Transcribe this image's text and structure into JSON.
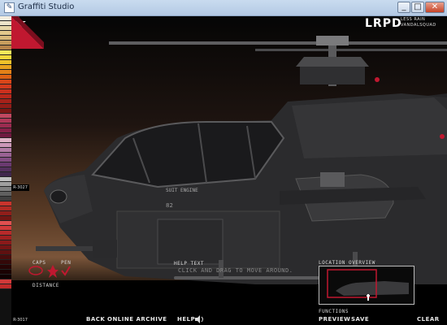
{
  "window": {
    "title": "Graffiti Studio",
    "minimize": "_",
    "maximize": "□",
    "close": "✕"
  },
  "palette": {
    "colors": [
      "#f4efe1",
      "#ece3c9",
      "#e6d6a8",
      "#e2c98c",
      "#d8b97a",
      "#c79d5e",
      "#b6834a",
      "#f5e85a",
      "#f2d83a",
      "#efc22a",
      "#e9a21e",
      "#e38118",
      "#dd6114",
      "#d8461a",
      "#d23a1e",
      "#c9301e",
      "#b8281c",
      "#a5221a",
      "#921d18",
      "#7c1714",
      "#c04860",
      "#b03858",
      "#9a2c50",
      "#862048",
      "#6f1a40",
      "#e0b4c8",
      "#cc98b8",
      "#b27ca6",
      "#9a6294",
      "#824c82",
      "#6a3a70",
      "#54305e",
      "#40264c",
      "#c0c0c0",
      "#a0a0a0",
      "#808080",
      "#606060",
      "#404040",
      "#c8342c",
      "#b02a24",
      "#901e1a",
      "#701614",
      "#e05050",
      "#d03a3a",
      "#b82a2a",
      "#a02020",
      "#8a1a1a",
      "#741414",
      "#5e1010",
      "#480c0c",
      "#340808",
      "#260404",
      "#1a0202",
      "#100000",
      "#d03a3a",
      "#c02a2a"
    ]
  },
  "logo": {
    "text": "LRPD",
    "sub_line1": "LESS RAIN",
    "sub_line2": "VANDALSQUAD",
    "icon": "star-splat-icon"
  },
  "codes": {
    "top": "R-3027",
    "bottom": "R-3017"
  },
  "tools": {
    "caps_label": "CAPS",
    "pen_label": "PEN",
    "distance_label": "DISTANCE"
  },
  "help": {
    "title": "HELP TEXT",
    "text": "CLICK AND DRAG TO MOVE AROUND."
  },
  "overview": {
    "label": "LOCATION OVERVIEW"
  },
  "functions": {
    "label": "FUNCTIONS",
    "preview": "PREVIEW",
    "save": "SAVE"
  },
  "nav": {
    "back": "BACK",
    "archive": "ONLINE ARCHIVE",
    "help": "HELP",
    "clear": "CLEAR",
    "sound_icon": "speaker-icon"
  },
  "helicopter": {
    "hull_number": "82",
    "nose_text": "SUIT ENGINE"
  },
  "colors": {
    "accent_red": "#c01830",
    "hull": "#2a2a2c",
    "sky_mid": "#5b3c26"
  }
}
